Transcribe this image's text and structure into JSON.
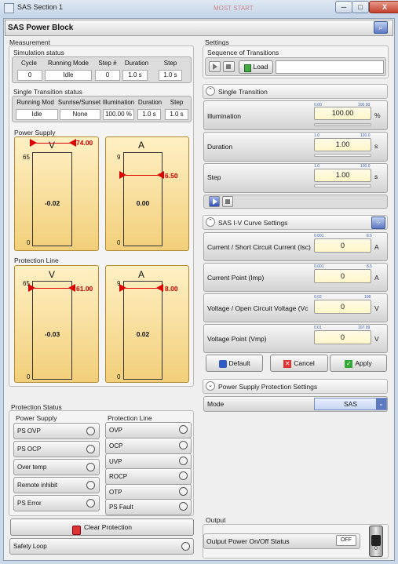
{
  "window": {
    "title": "SAS Section 1",
    "ghost": "MOST START",
    "min": "─",
    "max": "□",
    "close": "X"
  },
  "header": {
    "title": "SAS Power Block",
    "icon": "search-icon"
  },
  "measurement": {
    "title": "Measurement",
    "sim_status": {
      "title": "Simulation status",
      "cols": [
        "Cycle",
        "Running Mode",
        "Step #",
        "Duration",
        "Step"
      ],
      "vals": [
        "0",
        "Idle",
        "0",
        "1.0 s",
        "1.0 s"
      ]
    },
    "single_status": {
      "title": "Single Transition status",
      "cols": [
        "Running Mod",
        "Sunrise/Sunset",
        "Illumination",
        "Duration",
        "Step"
      ],
      "vals": [
        "Idle",
        "None",
        "100.00 %",
        "1.0 s",
        "1.0 s"
      ]
    },
    "power_supply": {
      "title": "Power Supply",
      "v": {
        "unit": "V",
        "top_tick": "65",
        "bottom_tick": "0",
        "value": "-0.02",
        "limit": "74.00"
      },
      "a": {
        "unit": "A",
        "top_tick": "9",
        "bottom_tick": "0",
        "value": "0.00",
        "limit": "6.50"
      }
    },
    "protection_line": {
      "title": "Protection Line",
      "v": {
        "unit": "V",
        "top_tick": "65",
        "bottom_tick": "0",
        "value": "-0.03",
        "limit": "61.00"
      },
      "a": {
        "unit": "A",
        "top_tick": "9",
        "bottom_tick": "0",
        "value": "0.02",
        "limit": "8.00"
      }
    }
  },
  "protection_status": {
    "title": "Protection Status",
    "ps_title": "Power Supply",
    "ps_items": [
      "PS OVP",
      "PS OCP",
      "Over temp",
      "Remote inhibit",
      "PS Error"
    ],
    "pl_title": "Protection Line",
    "pl_items": [
      "OVP",
      "OCP",
      "UVP",
      "ROCP",
      "OTP",
      "PS Fault"
    ],
    "clear_label": "Clear Protection",
    "safety_loop": "Safety Loop"
  },
  "settings": {
    "title": "Settings",
    "sequence": {
      "title": "Sequence of Transitions",
      "load_label": "Load",
      "file_value": ""
    },
    "single": {
      "title": "Single Transition",
      "illumination": {
        "label": "Illumination",
        "min": "0.00",
        "max": "100.00",
        "value": "100.00",
        "unit": "%",
        "fill": 1.0
      },
      "duration": {
        "label": "Duration",
        "min": "1.0",
        "max": "120.0",
        "value": "1.00",
        "unit": "s",
        "fill": 0.0
      },
      "step": {
        "label": "Step",
        "min": "1.0",
        "max": "100.0",
        "value": "1.00",
        "unit": "s",
        "fill": 0.0
      }
    },
    "iv": {
      "title": "SAS I-V Curve Settings",
      "isc": {
        "label": "Current / Short Circuit Current (Isc)",
        "min": "0.001",
        "max": "8.5",
        "value": "0",
        "unit": "A"
      },
      "imp": {
        "label": "Current Point (Imp)",
        "min": "0.001",
        "max": "8.5",
        "value": "0",
        "unit": "A"
      },
      "voc": {
        "label": "Voltage / Open Circuit Voltage (Vc",
        "min": "0.02",
        "max": "108",
        "value": "0",
        "unit": "V"
      },
      "vmp": {
        "label": "Voltage Point (Vmp)",
        "min": "0.01",
        "max": "107.99",
        "value": "0",
        "unit": "V"
      },
      "default_label": "Default",
      "cancel_label": "Cancel",
      "apply_label": "Apply"
    },
    "psp": {
      "title": "Power Supply Protection Settings",
      "mode_label": "Mode",
      "mode_value": "SAS"
    }
  },
  "output": {
    "title": "Output",
    "status_label": "Output Power On/Off Status",
    "status_value": "OFF",
    "switch_on": "I",
    "switch_off": "0"
  }
}
